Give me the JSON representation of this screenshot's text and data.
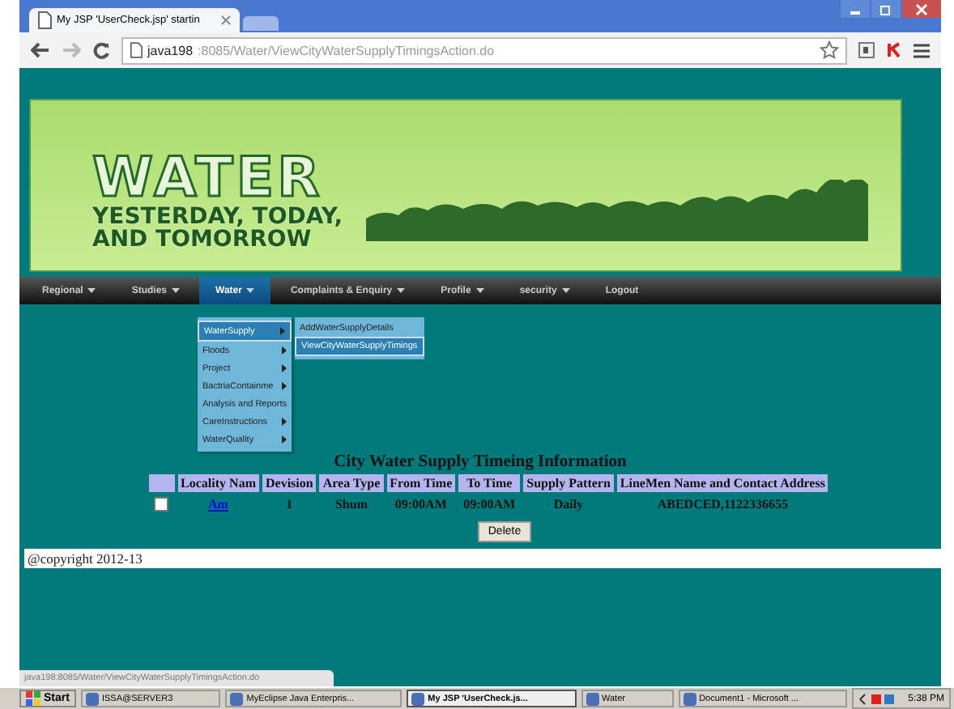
{
  "browser": {
    "tab_title": "My JSP 'UserCheck.jsp' startin",
    "url_host": "java198",
    "url_path": ":8085/Water/ViewCityWaterSupplyTimingsAction.do",
    "status_url": "java198:8085/Water/ViewCityWaterSupplyTimingsAction.do"
  },
  "banner": {
    "title": "WATER",
    "tagline_1": "YESTERDAY, TODAY,",
    "tagline_2": "AND TOMORROW"
  },
  "nav": [
    {
      "label": "Regional",
      "has_menu": true,
      "selected": false
    },
    {
      "label": "Studies",
      "has_menu": true,
      "selected": false
    },
    {
      "label": "Water",
      "has_menu": true,
      "selected": true
    },
    {
      "label": "Complaints & Enquiry",
      "has_menu": true,
      "selected": false
    },
    {
      "label": "Profile",
      "has_menu": true,
      "selected": false
    },
    {
      "label": "security",
      "has_menu": true,
      "selected": false
    },
    {
      "label": "Logout",
      "has_menu": false,
      "selected": false
    }
  ],
  "menu": [
    {
      "label": "WaterSupply",
      "has_submenu": true,
      "selected": true
    },
    {
      "label": "Floods",
      "has_submenu": true,
      "selected": false
    },
    {
      "label": "Project",
      "has_submenu": true,
      "selected": false
    },
    {
      "label": "BactriaContainme",
      "has_submenu": true,
      "selected": false
    },
    {
      "label": "Analysis and Reports",
      "has_submenu": false,
      "selected": false
    },
    {
      "label": "CareInstructions",
      "has_submenu": true,
      "selected": false
    },
    {
      "label": "WaterQuality",
      "has_submenu": true,
      "selected": false
    }
  ],
  "submenu": [
    {
      "label": "AddWaterSupplyDetails",
      "selected": false
    },
    {
      "label": "ViewCityWaterSupplyTimings",
      "selected": true
    }
  ],
  "heading": "City Water Supply Timeing Information",
  "table": {
    "columns": [
      "Locality Nam",
      "Devision",
      "Area Type",
      "From Time",
      "To Time",
      "Supply Pattern",
      "LineMen Name and Contact Address"
    ],
    "rows": [
      {
        "checked": false,
        "cells": [
          "Am",
          "1",
          "Shum",
          "09:00AM",
          "09:00AM",
          "Daily",
          "ABEDCED,1122336655"
        ]
      }
    ]
  },
  "delete_button": "Delete",
  "footer": "@copyright 2012-13",
  "taskbar": {
    "start": "Start",
    "items": [
      {
        "label": "ISSA@SERVER3",
        "selected": false
      },
      {
        "label": "MyEclipse Java Enterpris...",
        "selected": false
      },
      {
        "label": "My JSP 'UserCheck.js...",
        "selected": true
      },
      {
        "label": "Water",
        "selected": false
      },
      {
        "label": "Document1 - Microsoft ...",
        "selected": false
      }
    ],
    "clock": "5:38 PM"
  }
}
